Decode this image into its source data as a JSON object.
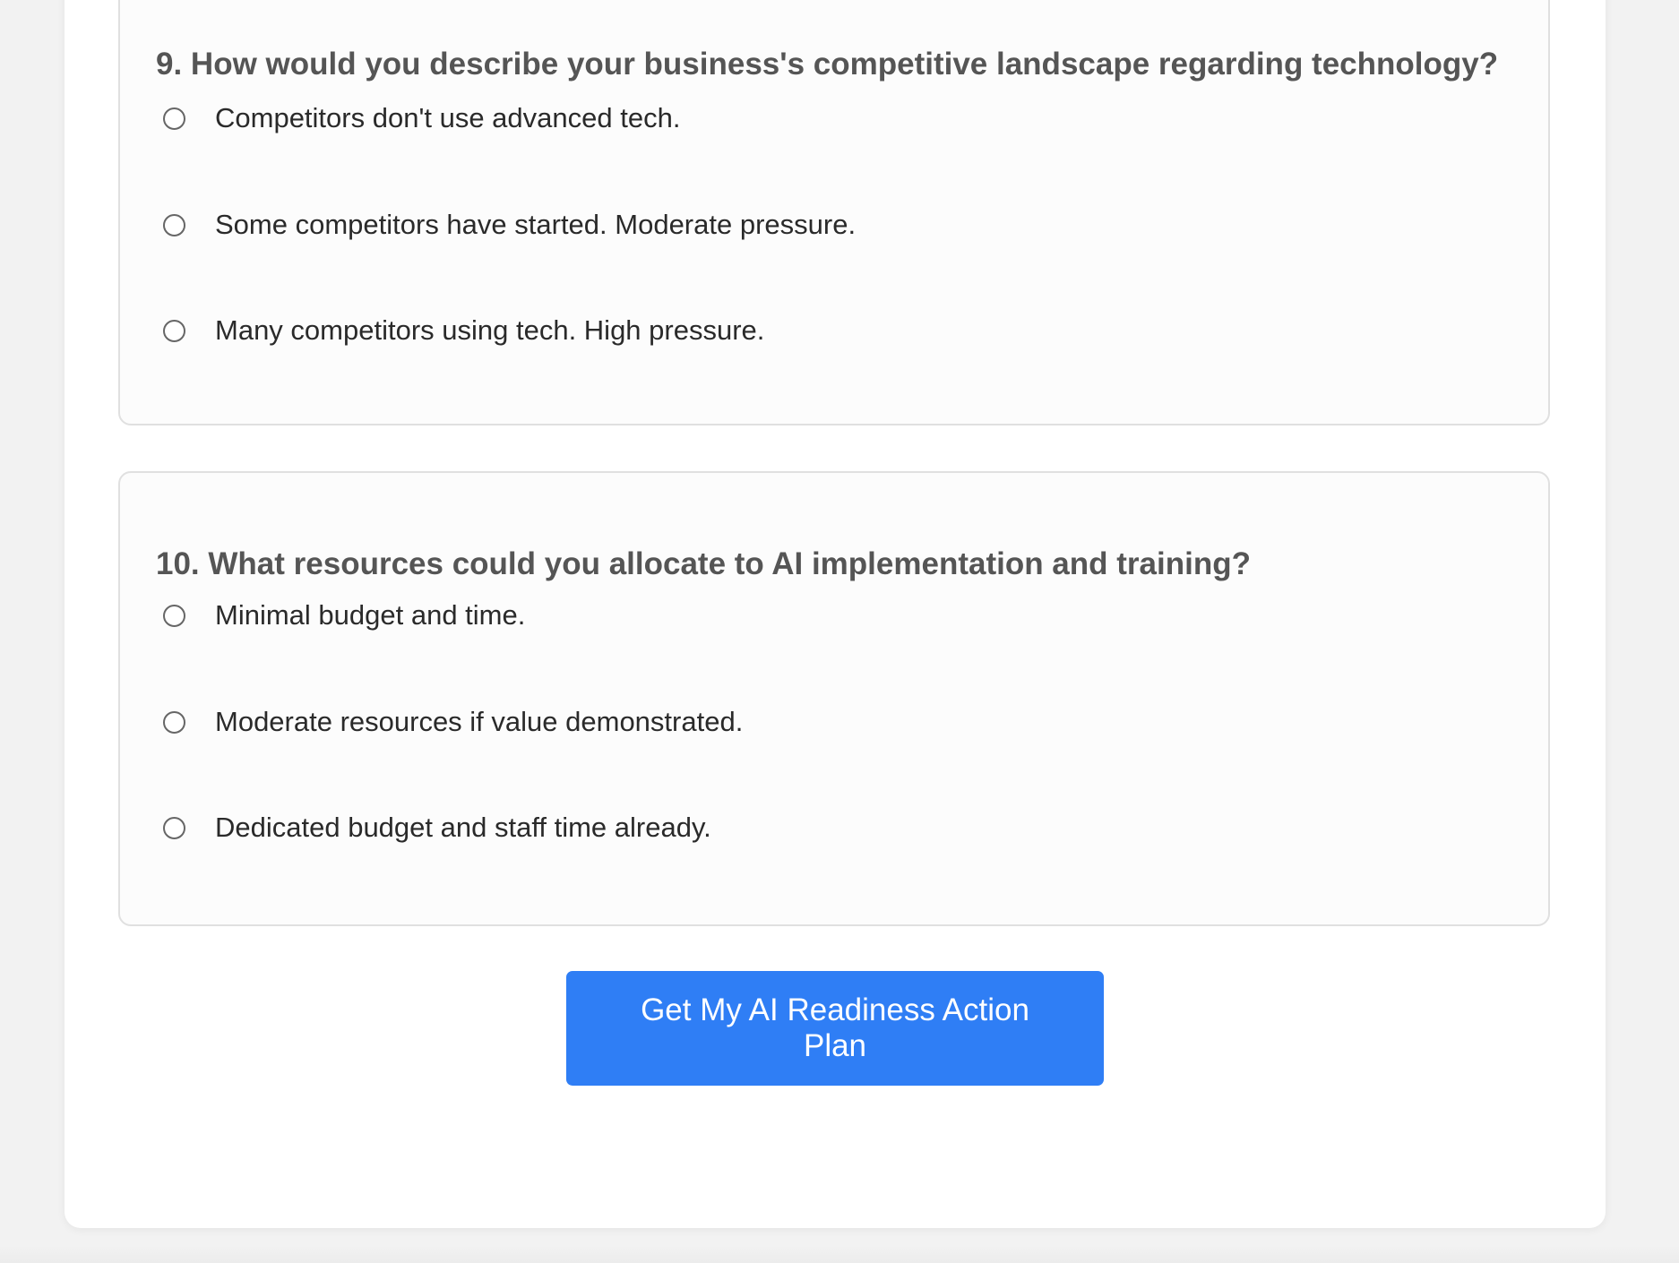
{
  "questions": [
    {
      "title": "9. How would you describe your business's competitive landscape regarding technology?",
      "options": [
        "Competitors don't use advanced tech.",
        "Some competitors have started. Moderate pressure.",
        "Many competitors using tech. High pressure."
      ]
    },
    {
      "title": "10. What resources could you allocate to AI implementation and training?",
      "options": [
        "Minimal budget and time.",
        "Moderate resources if value demonstrated.",
        "Dedicated budget and staff time already."
      ]
    }
  ],
  "submit_label": "Get My AI Readiness Action Plan",
  "colors": {
    "accent": "#2f7ef5",
    "page_background": "#f2f2f2",
    "card_background": "#ffffff",
    "question_background": "#fcfcfc",
    "question_border": "#e0e0e0",
    "title_text": "#555555"
  }
}
